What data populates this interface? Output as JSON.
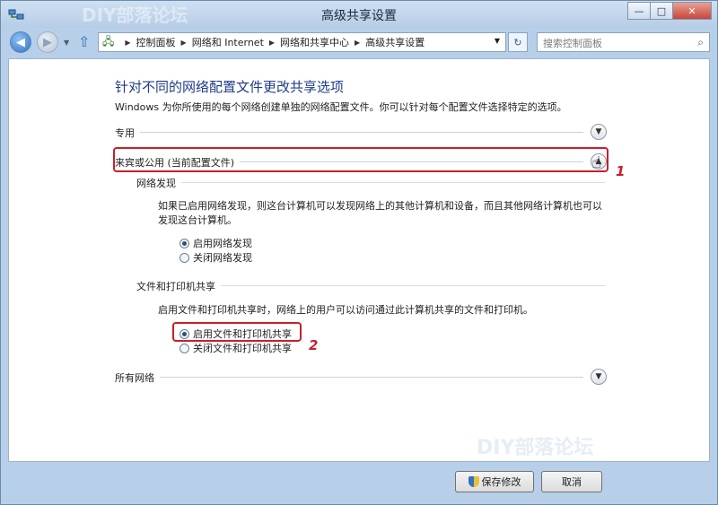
{
  "window": {
    "title": "高级共享设置"
  },
  "titlebar_buttons": {
    "minimize": "—",
    "maximize": "□",
    "close": "✕"
  },
  "nav": {
    "breadcrumb": [
      "控制面板",
      "网络和 Internet",
      "网络和共享中心",
      "高级共享设置"
    ],
    "search_placeholder": "搜索控制面板"
  },
  "page": {
    "heading": "针对不同的网络配置文件更改共享选项",
    "description": "Windows 为你所使用的每个网络创建单独的网络配置文件。你可以针对每个配置文件选择特定的选项。",
    "profiles": [
      {
        "label": "专用",
        "state": "collapsed"
      },
      {
        "label": "来宾或公用 (当前配置文件)",
        "state": "expanded"
      },
      {
        "label": "所有网络",
        "state": "collapsed"
      }
    ],
    "network_discovery": {
      "title": "网络发现",
      "text": "如果已启用网络发现，则这台计算机可以发现网络上的其他计算机和设备，而且其他网络计算机也可以发现这台计算机。",
      "options": [
        "启用网络发现",
        "关闭网络发现"
      ],
      "selected": 0
    },
    "file_printer_sharing": {
      "title": "文件和打印机共享",
      "text": "启用文件和打印机共享时，网络上的用户可以访问通过此计算机共享的文件和打印机。",
      "options": [
        "启用文件和打印机共享",
        "关闭文件和打印机共享"
      ],
      "selected": 0
    }
  },
  "annotations": {
    "step1": "1",
    "step2": "2"
  },
  "watermark": "DIY部落论坛",
  "buttons": {
    "save": "保存修改",
    "cancel": "取消"
  },
  "colors": {
    "heading": "#1f3c88",
    "annotation": "#c8202a"
  }
}
